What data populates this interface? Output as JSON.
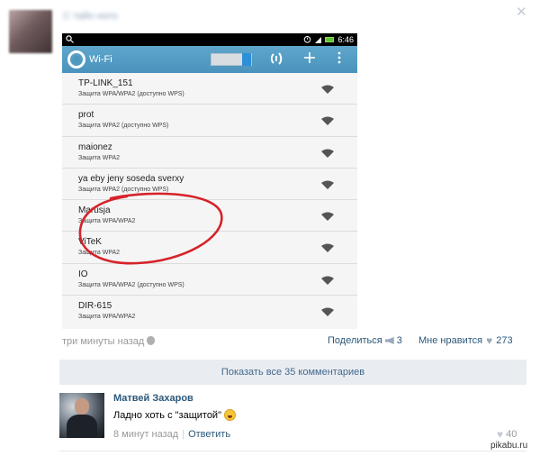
{
  "post": {
    "author": "С тайн нелз",
    "time": "три минуты назад",
    "share_label": "Поделиться",
    "share_count": "3",
    "like_label": "Мне нравится",
    "like_count": "273",
    "close_glyph": "✕"
  },
  "phone": {
    "status_time": "6:46",
    "title": "Wi-Fi",
    "networks": [
      {
        "name": "TP-LINK_151",
        "security": "Защита WPA/WPA2 (доступно WPS)"
      },
      {
        "name": "prot",
        "security": "Защита WPA2 (доступно WPS)"
      },
      {
        "name": "maionez",
        "security": "Защита WPA2"
      },
      {
        "name": "ya eby jeny soseda sverxy",
        "security": "Защита WPA2 (доступно WPS)"
      },
      {
        "name": "Marusja",
        "security": "Защита WPA/WPA2"
      },
      {
        "name": "ViTeK",
        "security": "Защита WPA2"
      },
      {
        "name": "IO",
        "security": "Защита WPA/WPA2 (доступно WPS)"
      },
      {
        "name": "DIR-615",
        "security": "Защита WPA/WPA2"
      }
    ],
    "highlight_color": "#d6222a"
  },
  "comments_bar": {
    "label": "Показать все 35 комментариев"
  },
  "comment": {
    "author": "Матвей Захаров",
    "text": "Ладно хоть с \"защитой\"",
    "time": "8 минут назад",
    "reply_label": "Ответить",
    "like_count": "40"
  },
  "watermark": "pikabu.ru",
  "colors": {
    "link": "#2b587a",
    "bar_bg": "#e9edf1",
    "android_blue": "#4a93bc"
  }
}
